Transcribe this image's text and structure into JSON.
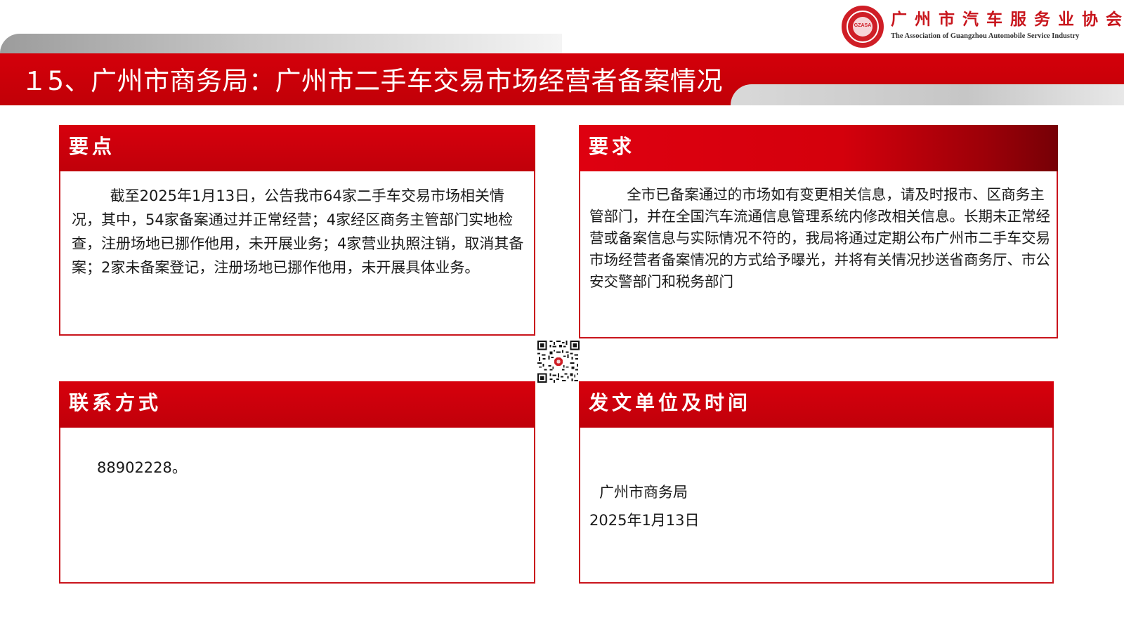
{
  "header": {
    "title": "１5、广州市商务局：广州市二手车交易市场经营者备案情况"
  },
  "logo": {
    "name_cn": "广州市汽车服务业协会",
    "name_en": "The Association of Guangzhou Automobile Service Industry",
    "seal_text": "GZASA",
    "icon": "association-seal-logo"
  },
  "panels": {
    "key_points": {
      "heading": "要点",
      "body": "截至2025年1月13日，公告我市64家二手车交易市场相关情况，其中，54家备案通过并正常经营；4家经区商务主管部门实地检查，注册场地已挪作他用，未开展业务；4家营业执照注销，取消其备案；2家未备案登记，注册场地已挪作他用，未开展具体业务。"
    },
    "requirements": {
      "heading": "要求",
      "body": "全市已备案通过的市场如有变更相关信息，请及时报市、区商务主管部门，并在全国汽车流通信息管理系统内修改相关信息。长期未正常经营或备案信息与实际情况不符的，我局将通过定期公布广州市二手车交易市场经营者备案情况的方式给予曝光，并将有关情况抄送省商务厅、市公安交警部门和税务部门"
    },
    "contact": {
      "heading": "联系方式",
      "body": "88902228。"
    },
    "issuer": {
      "heading": "发文单位及时间",
      "org": "广州市商务局",
      "date": "2025年1月13日"
    }
  },
  "qr_code": {
    "icon": "qr-code-icon"
  },
  "colors": {
    "brand_red": "#c9141c",
    "title_band": "#d4000a"
  }
}
